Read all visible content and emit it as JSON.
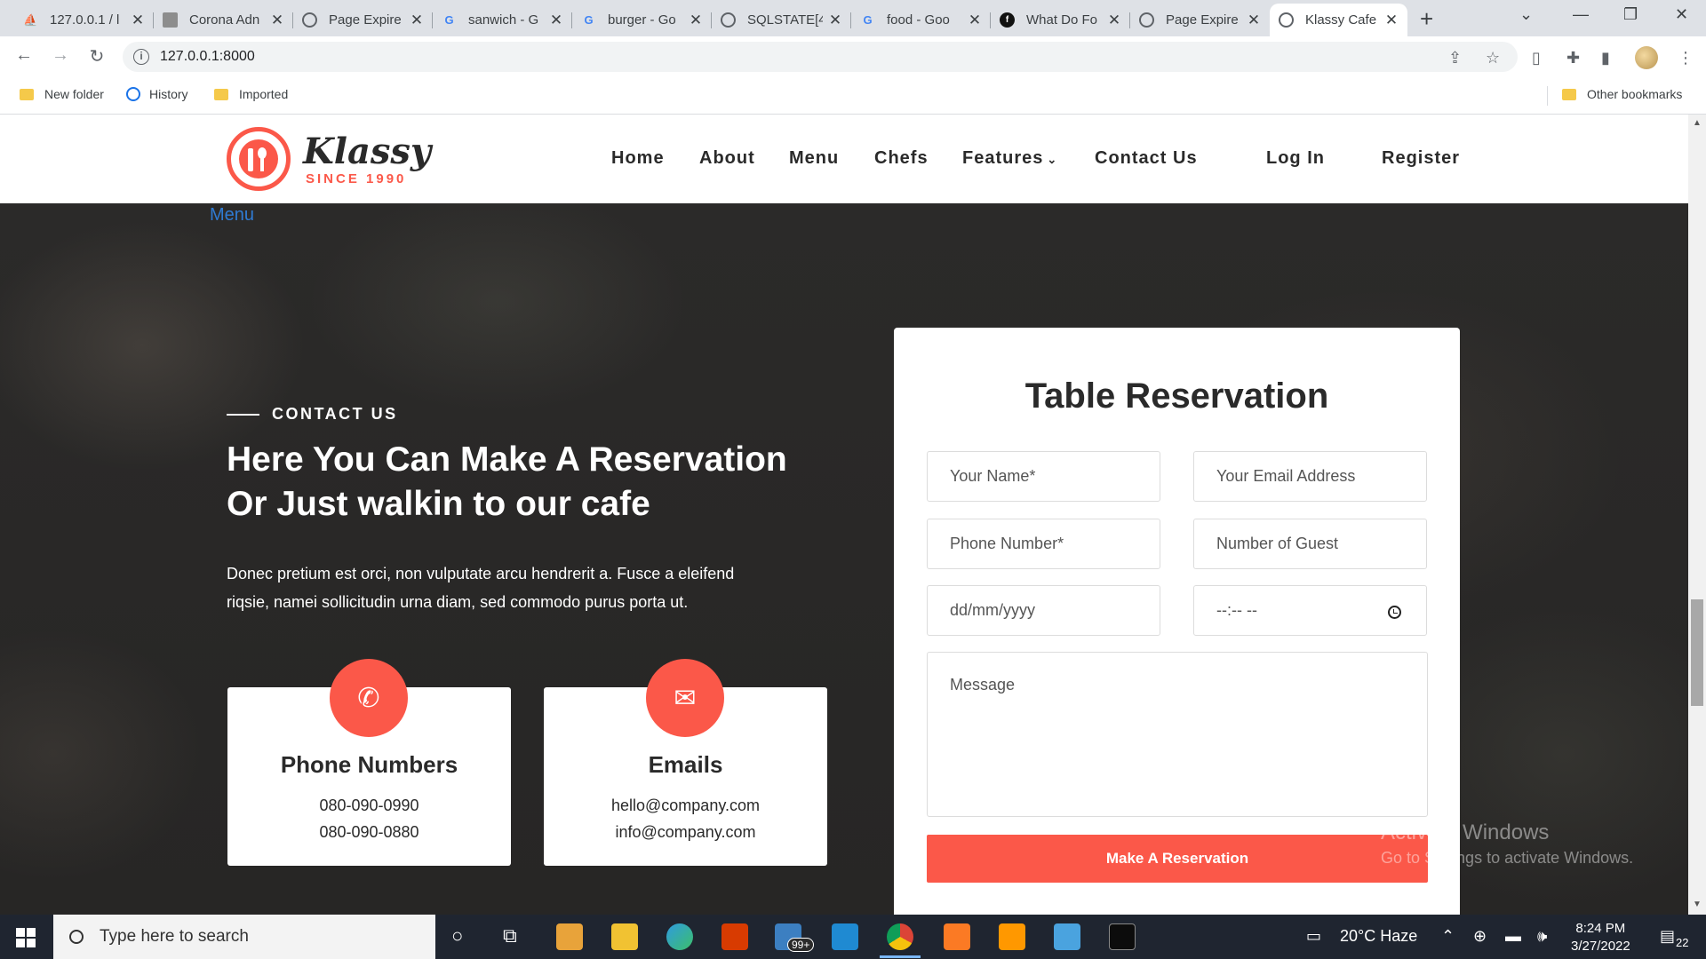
{
  "browser": {
    "tabs": [
      {
        "label": "127.0.0.1 / l",
        "icon": "phpmyadmin-icon",
        "color": "#f29111"
      },
      {
        "label": "Corona Adn",
        "icon": "page-icon",
        "color": "#8d8d8d"
      },
      {
        "label": "Page Expire",
        "icon": "globe-icon",
        "color": "#5f6368"
      },
      {
        "label": "sanwich - G",
        "icon": "google-icon",
        "color": "#4285f4"
      },
      {
        "label": "burger - Go",
        "icon": "google-icon",
        "color": "#4285f4"
      },
      {
        "label": "SQLSTATE[4",
        "icon": "globe-icon",
        "color": "#5f6368"
      },
      {
        "label": "food - Goo",
        "icon": "google-icon",
        "color": "#4285f4"
      },
      {
        "label": "What Do Fo",
        "icon": "site-icon",
        "color": "#111111"
      },
      {
        "label": "Page Expire",
        "icon": "globe-icon",
        "color": "#5f6368"
      },
      {
        "label": "Klassy Cafe",
        "icon": "globe-icon",
        "color": "#5f6368",
        "active": true
      }
    ],
    "url": "127.0.0.1:8000",
    "bookmarks": {
      "new_folder": "New folder",
      "history": "History",
      "imported": "Imported",
      "other": "Other bookmarks"
    }
  },
  "site": {
    "logo_name": "Klassy",
    "logo_since": "SINCE 1990",
    "nav": {
      "home": "Home",
      "about": "About",
      "menu": "Menu",
      "chefs": "Chefs",
      "features": "Features",
      "contact": "Contact Us",
      "login": "Log In",
      "register": "Register"
    },
    "breadcrumb": "Menu",
    "eyebrow": "CONTACT US",
    "headline_1": "Here You Can Make A Reservation",
    "headline_2": "Or Just walkin to our cafe",
    "paragraph_1": "Donec pretium est orci, non vulputate arcu hendrerit a. Fusce a eleifend",
    "paragraph_2": "riqsie, namei sollicitudin urna diam, sed commodo purus porta ut.",
    "phone_card": {
      "title": "Phone Numbers",
      "line1": "080-090-0990",
      "line2": "080-090-0880"
    },
    "email_card": {
      "title": "Emails",
      "line1": "hello@company.com",
      "line2": "info@company.com"
    },
    "form": {
      "title": "Table Reservation",
      "name_placeholder": "Your Name*",
      "email_placeholder": "Your Email Address",
      "phone_placeholder": "Phone Number*",
      "guests_placeholder": "Number of Guest",
      "date_placeholder": "dd/mm/yyyy",
      "time_placeholder": "--:-- --",
      "message_placeholder": "Message",
      "submit": "Make A Reservation"
    },
    "accent_color": "#fb5849"
  },
  "os": {
    "activate_title": "Activate Windows",
    "activate_sub": "Go to Settings to activate Windows.",
    "search_placeholder": "Type here to search",
    "weather": "20°C  Haze",
    "time": "8:24 PM",
    "date": "3/27/2022",
    "mail_badge": "99+",
    "notifications": "22"
  }
}
